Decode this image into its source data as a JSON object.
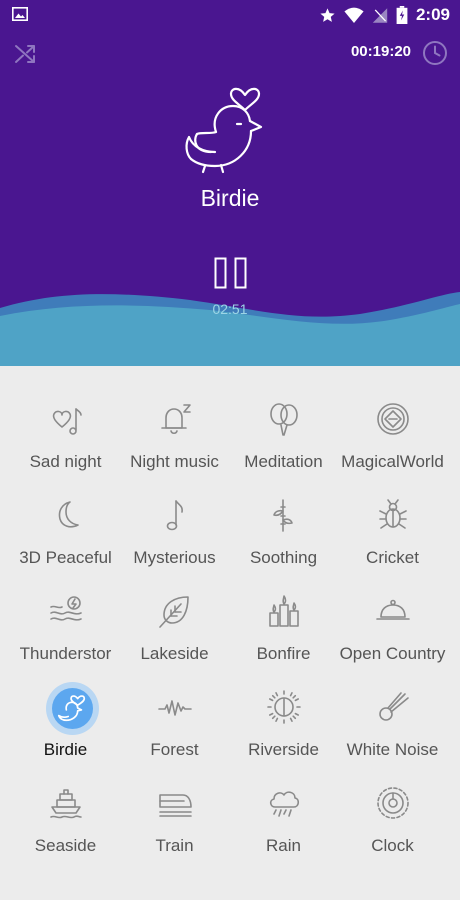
{
  "status_bar": {
    "time": "2:09"
  },
  "player": {
    "timer": "00:19:20",
    "title": "Birdie",
    "elapsed": "02:51"
  },
  "colors": {
    "hero_bg": "#4a1690",
    "wave": "#4fa3c6",
    "active": "#5ca7ef"
  },
  "sounds": [
    {
      "label": "Sad night",
      "icon": "heart-note-icon"
    },
    {
      "label": "Night music",
      "icon": "bell-icon"
    },
    {
      "label": "Meditation",
      "icon": "balloons-icon"
    },
    {
      "label": "MagicalWorld",
      "icon": "gem-icon"
    },
    {
      "label": "3D Peaceful",
      "icon": "moon-icon"
    },
    {
      "label": "Mysterious",
      "icon": "music-note-icon"
    },
    {
      "label": "Soothing",
      "icon": "bamboo-icon"
    },
    {
      "label": "Cricket",
      "icon": "bug-icon"
    },
    {
      "label": "Thunderstor",
      "icon": "thunder-waves-icon"
    },
    {
      "label": "Lakeside",
      "icon": "leaf-icon"
    },
    {
      "label": "Bonfire",
      "icon": "candles-icon"
    },
    {
      "label": "Open Country",
      "icon": "cloche-icon"
    },
    {
      "label": "Birdie",
      "icon": "bird-icon",
      "active": true
    },
    {
      "label": "Forest",
      "icon": "waveform-icon"
    },
    {
      "label": "Riverside",
      "icon": "sun-icon"
    },
    {
      "label": "White Noise",
      "icon": "comet-icon"
    },
    {
      "label": "Seaside",
      "icon": "ship-icon"
    },
    {
      "label": "Train",
      "icon": "train-icon"
    },
    {
      "label": "Rain",
      "icon": "rain-cloud-icon"
    },
    {
      "label": "Clock",
      "icon": "clock-icon"
    }
  ]
}
